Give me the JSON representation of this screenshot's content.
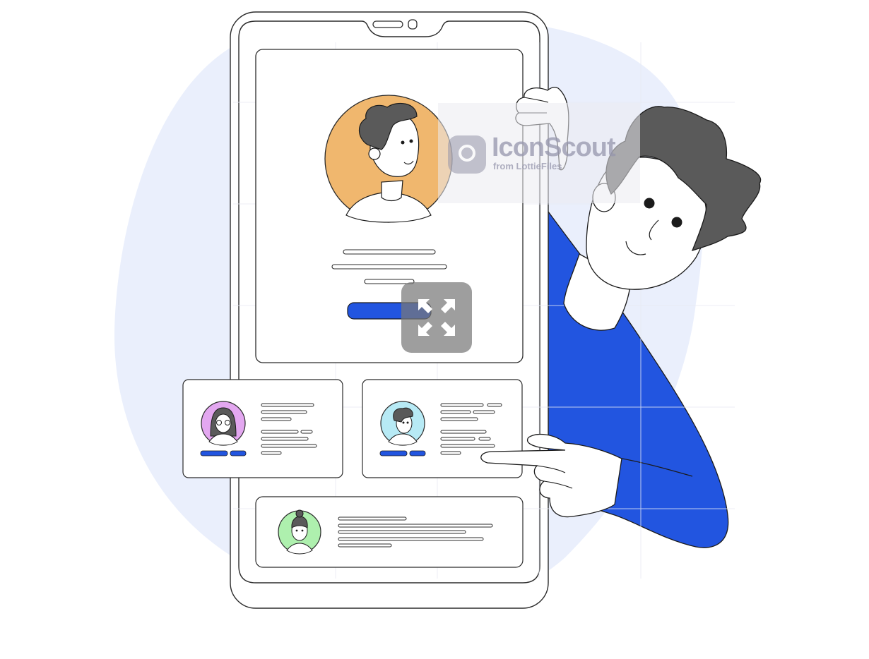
{
  "watermark": {
    "title": "IconScout",
    "subtitle": "from LottieFiles"
  },
  "controls": {
    "expand_icon": "expand-arrows-icon"
  },
  "colors": {
    "blob": "#eaeffc",
    "shirt": "#2255e0",
    "hair": "#5a5a5a",
    "accent_button": "#2255e0",
    "avatar_main": "#f0b76e",
    "avatar_pink": "#e3a7f0",
    "avatar_cyan": "#b7eaf5",
    "avatar_green": "#aef0ae"
  }
}
